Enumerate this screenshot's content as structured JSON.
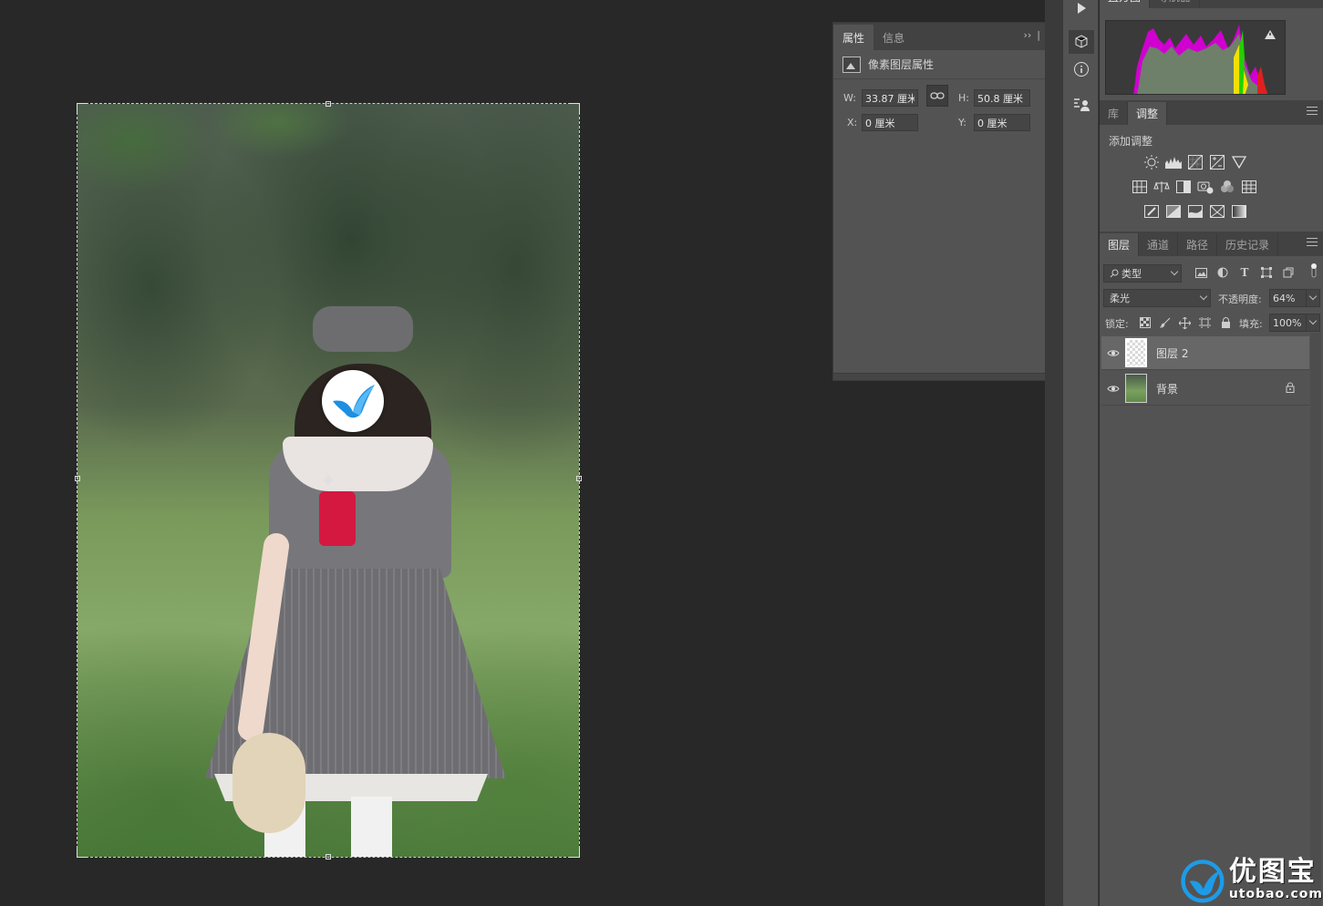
{
  "properties_panel": {
    "tabs": [
      {
        "label": "属性",
        "active": true
      },
      {
        "label": "信息",
        "active": false
      }
    ],
    "expand_label": "››",
    "section_title": "像素图层属性",
    "w_label": "W:",
    "w_value": "33.87 厘米",
    "h_label": "H:",
    "h_value": "50.8 厘米",
    "x_label": "X:",
    "x_value": "0 厘米",
    "y_label": "Y:",
    "y_value": "0 厘米"
  },
  "histogram_tabs": [
    {
      "label": "直方图"
    },
    {
      "label": "导航器"
    }
  ],
  "adjustments_panel": {
    "tabs": [
      {
        "label": "库",
        "active": false
      },
      {
        "label": "调整",
        "active": true
      }
    ],
    "title": "添加调整",
    "icon_rows": [
      [
        "brightness-icon",
        "levels-icon",
        "curves-icon",
        "exposure-icon",
        "vibrance-icon"
      ],
      [
        "hue-saturation-icon",
        "color-balance-icon",
        "black-white-icon",
        "photo-filter-icon",
        "channel-mixer-icon",
        "color-lookup-icon"
      ],
      [
        "invert-icon",
        "posterize-icon",
        "threshold-icon",
        "selective-color-icon",
        "gradient-map-icon"
      ]
    ]
  },
  "layers_panel": {
    "tabs": [
      {
        "label": "图层",
        "active": true
      },
      {
        "label": "通道",
        "active": false
      },
      {
        "label": "路径",
        "active": false
      },
      {
        "label": "历史记录",
        "active": false
      }
    ],
    "filter_value": "类型",
    "blend_mode": "柔光",
    "opacity_label": "不透明度:",
    "opacity_value": "64%",
    "lock_label": "锁定:",
    "fill_label": "填充:",
    "fill_value": "100%",
    "layers": [
      {
        "name": "图层 2",
        "selected": true,
        "locked": false
      },
      {
        "name": "背景",
        "selected": false,
        "locked": true
      }
    ]
  },
  "watermark": {
    "cn": "优图宝",
    "en": "utobao.com"
  },
  "colors": {
    "panel": "#535353",
    "tab_bar": "#424242",
    "workspace": "#282828",
    "accent_blue": "#1e9be8"
  }
}
